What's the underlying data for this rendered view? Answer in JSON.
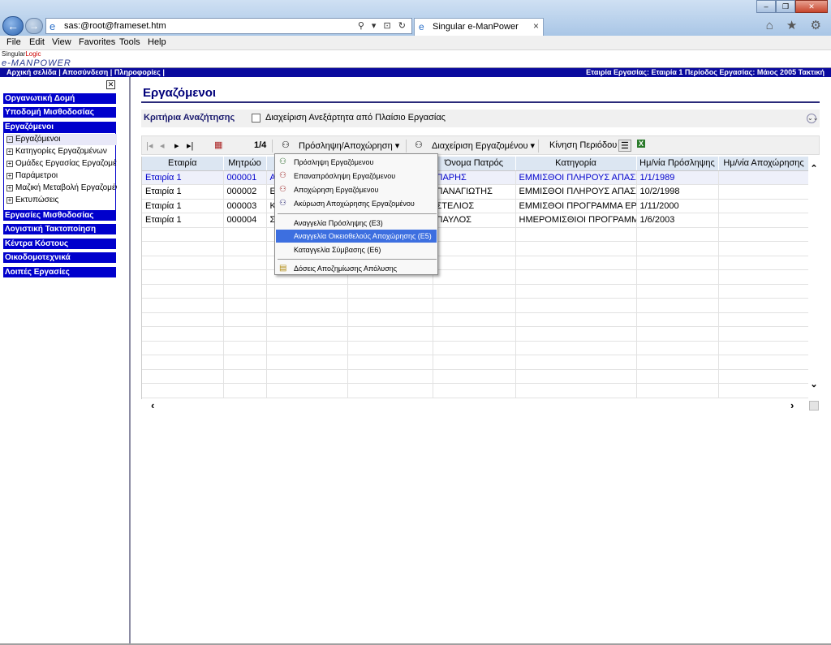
{
  "browser": {
    "address": "sas:@root@frameset.htm",
    "tab_title": "Singular e-ManPower",
    "address_tools": "⚲ ▾ ⊡ ↻",
    "tab_close": "×",
    "menu": [
      "File",
      "Edit",
      "View",
      "Favorites",
      "Tools",
      "Help"
    ],
    "window_controls": [
      "–",
      "❐",
      "✕"
    ],
    "right_icons": "⌂ ★ ⚙"
  },
  "app": {
    "logo_top_a": "Singular",
    "logo_top_b": "Logic",
    "logo_bottom": "e-MANPOWER",
    "topbar_links": "Αρχική σελίδα  |  Αποσύνδεση  |  Πληροφορίες  |",
    "topbar_info": "Εταιρία Εργασίας: Εταιρία 1   Περίοδος Εργασίας: Μάιος 2005 Τακτική",
    "sidebar_close": "✕"
  },
  "sidebar": {
    "sections_top": [
      "Οργανωτική Δομή",
      "Υποδομή Μισθοδοσίας"
    ],
    "active_section": "Εργαζόμενοι",
    "sub_items": [
      {
        "label": "Εργαζόμενοι",
        "box": "-"
      },
      {
        "label": "Κατηγορίες Εργαζομένων",
        "box": "+"
      },
      {
        "label": "Ομάδες Εργασίας Εργαζομένων",
        "box": "+"
      },
      {
        "label": "Παράμετροι",
        "box": "+"
      },
      {
        "label": "Μαζική Μεταβολή Εργαζομένων",
        "box": "+"
      },
      {
        "label": "Εκτυπώσεις",
        "box": "+"
      }
    ],
    "sections_bottom": [
      "Εργασίες Μισθοδοσίας",
      "Λογιστική Τακτοποίηση",
      "Κέντρα Κόστους",
      "Οικοδομοτεχνικά",
      "Λοιπές Εργασίες"
    ]
  },
  "main": {
    "title": "Εργαζόμενοι",
    "criteria_label": "Κριτήρια Αναζήτησης",
    "criteria_checkbox": "Διαχείριση Ανεξάρτητα από Πλαίσιο Εργασίας",
    "criteria_collapse": "⌄⌄"
  },
  "toolbar": {
    "nav": [
      "|◂",
      "◂",
      "▸",
      "▸|"
    ],
    "calendar_icon": "▦",
    "page": "1/4",
    "hire_menu": "Πρόσληψη/Αποχώρηση ▾",
    "manage_menu": "Διαχείριση Εργαζομένου ▾",
    "period_move": "Κίνηση Περιόδου",
    "people_icon": "⚇",
    "list_icon": "☰",
    "excel_icon": "X"
  },
  "grid": {
    "columns": [
      "Εταιρία",
      "Μητρώο",
      "",
      "",
      "Όνομα Πατρός",
      "Κατηγορία",
      "Ημ/νία Πρόσληψης",
      "Ημ/νία Αποχώρησης"
    ],
    "rows": [
      [
        "Εταιρία 1",
        "000001",
        "Α",
        "",
        "ΠΑΡΗΣ",
        "ΕΜΜΙΣΘΟΙ ΠΛΗΡΟΥΣ ΑΠΑΣΧ",
        "1/1/1989",
        ""
      ],
      [
        "Εταιρία 1",
        "000002",
        "Ε",
        "",
        "ΠΑΝΑΓΙΩΤΗΣ",
        "ΕΜΜΙΣΘΟΙ ΠΛΗΡΟΥΣ ΑΠΑΣΧ",
        "10/2/1998",
        ""
      ],
      [
        "Εταιρία 1",
        "000003",
        "Κ",
        "",
        "ΣΤΕΛΙΟΣ",
        "ΕΜΜΙΣΘΟΙ ΠΡΟΓΡΑΜΜΑ ΕΡΓ",
        "1/11/2000",
        ""
      ],
      [
        "Εταιρία 1",
        "000004",
        "Σ",
        "",
        "ΠΑΥΛΟΣ",
        "ΗΜΕΡΟΜΙΣΘΙΟΙ ΠΡΟΓΡΑΜΜΑ Ε",
        "1/6/2003",
        ""
      ]
    ],
    "scroll": {
      "up": "⌃",
      "down": "⌄",
      "left": "‹",
      "right": "›"
    }
  },
  "dropdown": {
    "group1": [
      {
        "label": "Πρόσληψη Εργαζόμενου",
        "icon": "⚇"
      },
      {
        "label": "Επαναπρόσληψη Εργαζόμενου",
        "icon": "⚇"
      },
      {
        "label": "Αποχώρηση Εργαζόμενου",
        "icon": "⚇"
      },
      {
        "label": "Ακύρωση Αποχώρησης Εργαζομένου",
        "icon": "⚇"
      }
    ],
    "group2": [
      {
        "label": "Αναγγελία Πρόσληψης (Ε3)"
      },
      {
        "label": "Αναγγελία Οικειοθελούς Αποχώρησης (Ε5)"
      },
      {
        "label": "Καταγγελία Σύμβασης (Ε6)"
      }
    ],
    "highlighted_index": 1,
    "group3": [
      {
        "label": "Δόσεις Αποζημίωσης Απόλυσης",
        "icon": "▤"
      }
    ]
  },
  "colors": {
    "nav_blue": "#0000cc",
    "header_navy": "#0a0a9e",
    "highlight": "#3d6fe0"
  }
}
